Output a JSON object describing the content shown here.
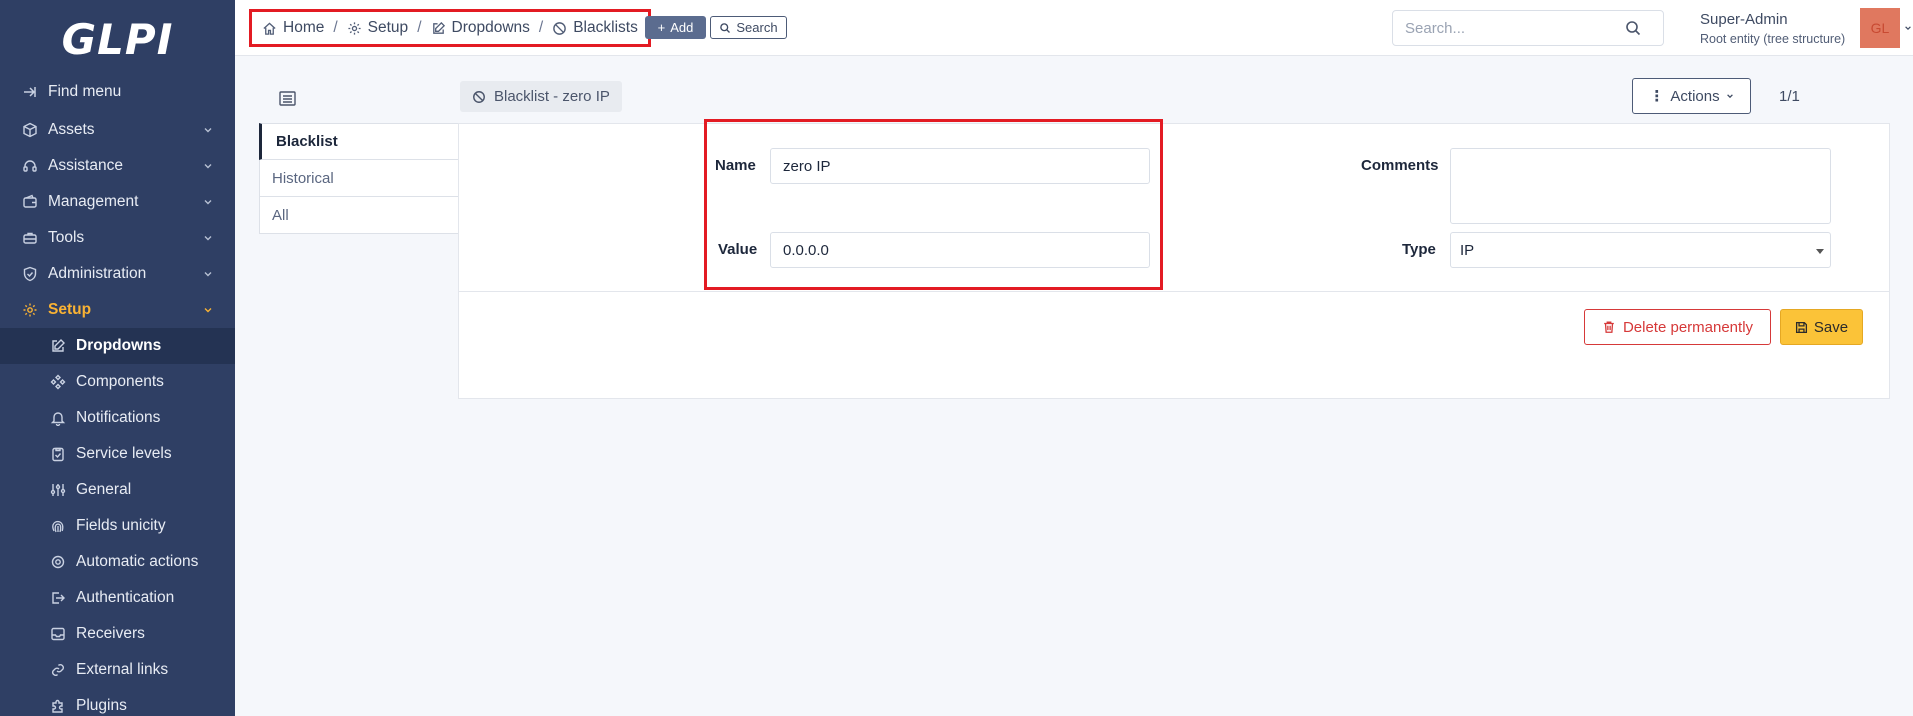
{
  "app": {
    "logo_text": "GLPI"
  },
  "sidebar": {
    "find_menu": "Find menu",
    "sections": [
      {
        "label": "Assets",
        "icon": "box-icon"
      },
      {
        "label": "Assistance",
        "icon": "headset-icon"
      },
      {
        "label": "Management",
        "icon": "wallet-icon"
      },
      {
        "label": "Tools",
        "icon": "briefcase-icon"
      },
      {
        "label": "Administration",
        "icon": "shield-check-icon"
      },
      {
        "label": "Setup",
        "icon": "gear-icon"
      }
    ],
    "setup_items": [
      {
        "label": "Dropdowns",
        "icon": "edit-icon"
      },
      {
        "label": "Components",
        "icon": "components-icon"
      },
      {
        "label": "Notifications",
        "icon": "bell-icon"
      },
      {
        "label": "Service levels",
        "icon": "clipboard-check-icon"
      },
      {
        "label": "General",
        "icon": "adjustments-icon"
      },
      {
        "label": "Fields unicity",
        "icon": "fingerprint-icon"
      },
      {
        "label": "Automatic actions",
        "icon": "cog-icon"
      },
      {
        "label": "Authentication",
        "icon": "login-icon"
      },
      {
        "label": "Receivers",
        "icon": "inbox-icon"
      },
      {
        "label": "External links",
        "icon": "link-icon"
      },
      {
        "label": "Plugins",
        "icon": "puzzle-icon"
      }
    ],
    "active_section": "Setup",
    "current_item": "Dropdowns",
    "accent_color": "#f9b234"
  },
  "topbar": {
    "breadcrumb": [
      "Home",
      "Setup",
      "Dropdowns",
      "Blacklists"
    ],
    "add_label": "Add",
    "search_label": "Search",
    "global_search_placeholder": "Search...",
    "user_name": "Super-Admin",
    "user_entity": "Root entity (tree structure)",
    "avatar_initials": "GL"
  },
  "item": {
    "title": "Blacklist - zero IP",
    "actions_label": "Actions",
    "pager": "1/1",
    "tabs": [
      "Blacklist",
      "Historical",
      "All"
    ],
    "form": {
      "name_label": "Name",
      "name_value": "zero IP",
      "value_label": "Value",
      "value_value": "0.0.0.0",
      "comments_label": "Comments",
      "comments_value": "",
      "type_label": "Type",
      "type_value": "IP"
    },
    "delete_label": "Delete permanently",
    "save_label": "Save"
  },
  "colors": {
    "sidebar_bg": "#2f3f64",
    "highlight_red": "#e31b23",
    "save_yellow": "#fbc338",
    "delete_red": "#d63939"
  }
}
